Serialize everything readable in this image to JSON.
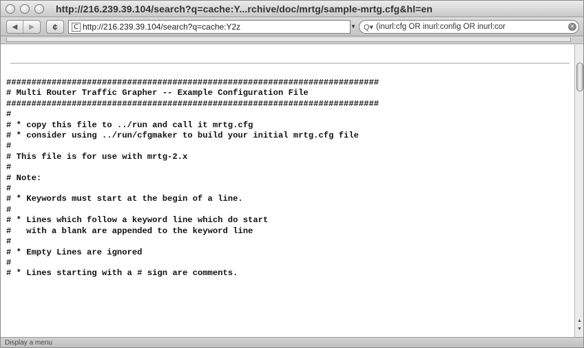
{
  "window": {
    "title": "http://216.239.39.104/search?q=cache:Y...rchive/doc/mrtg/sample-mrtg.cfg&hl=en"
  },
  "toolbar": {
    "back_icon": "back-arrow",
    "forward_icon": "forward-arrow",
    "reload_glyph": "¢",
    "address_favicon": "C",
    "address_value": "http://216.239.39.104/search?q=cache:Y2z",
    "search_value": "(inurl:cfg OR inurl:config OR inurl:cor"
  },
  "document": {
    "lines": [
      "##########################################################################",
      "# Multi Router Traffic Grapher -- Example Configuration File",
      "##########################################################################",
      "#",
      "# * copy this file to ../run and call it mrtg.cfg",
      "# * consider using ../run/cfgmaker to build your initial mrtg.cfg file",
      "#",
      "# This file is for use with mrtg-2.x",
      "#",
      "# Note:",
      "#",
      "# * Keywords must start at the begin of a line.",
      "#",
      "# * Lines which follow a keyword line which do start",
      "#   with a blank are appended to the keyword line",
      "#",
      "# * Empty Lines are ignored",
      "#",
      "# * Lines starting with a # sign are comments."
    ]
  },
  "status": {
    "text": "Display a menu"
  }
}
